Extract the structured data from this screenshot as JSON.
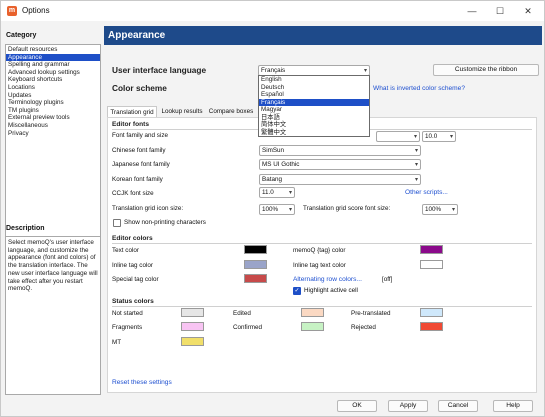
{
  "window": {
    "title": "Options",
    "icon_letter": "m"
  },
  "titlebar_buttons": {
    "minimize": "—",
    "maximize": "☐",
    "close": "✕"
  },
  "left": {
    "category_label": "Category",
    "categories": [
      "Default resources",
      "Appearance",
      "Spelling and grammar",
      "Advanced lookup settings",
      "Keyboard shortcuts",
      "Locations",
      "Updates",
      "Terminology plugins",
      "TM plugins",
      "External preview tools",
      "Miscellaneous",
      "Privacy"
    ],
    "selected_index": 1,
    "description_label": "Description",
    "description_text": "Select memoQ's user interface language, and customize the appearance (font and colors) of the translation interface. The new user interface language will take effect after you restart memoQ."
  },
  "main": {
    "header": "Appearance",
    "ui_language_label": "User interface language",
    "ui_language_value": "Français",
    "customize_ribbon_button": "Customize the ribbon",
    "color_scheme_label": "Color scheme",
    "inverted_link": "What is inverted color scheme?",
    "language_options": [
      "English",
      "Deutsch",
      "Español",
      "Français",
      "Magyar",
      "日本語",
      "简体中文",
      "繁體中文"
    ],
    "language_selected_index": 3,
    "tabs": [
      "Translation grid",
      "Lookup results",
      "Compare boxes"
    ],
    "editor_fonts": {
      "title": "Editor fonts",
      "font_family_label": "Font family and size",
      "font_size_value": "10.0",
      "chinese_label": "Chinese font family",
      "chinese_value": "SimSun",
      "japanese_label": "Japanese font family",
      "japanese_value": "MS UI Gothic",
      "korean_label": "Korean font family",
      "korean_value": "Batang",
      "ccjk_label": "CCJK font size",
      "ccjk_value": "11.0",
      "other_scripts_link": "Other scripts...",
      "grid_icon_label": "Translation grid icon size:",
      "grid_icon_value": "100%",
      "grid_score_label": "Translation grid score font size:",
      "grid_score_value": "100%",
      "show_nonprinting_label": "Show non-printing characters",
      "show_nonprinting_checked": false
    },
    "editor_colors": {
      "title": "Editor colors",
      "text_color_label": "Text color",
      "text_color": "#000000",
      "memoq_tag_label": "memoQ {tag} color",
      "memoq_tag_color": "#8b0a8b",
      "inline_tag_label": "Inline tag color",
      "inline_tag_color": "#9aa4c9",
      "inline_tag_text_label": "Inline tag text color",
      "inline_tag_text_color": "#ffffff",
      "special_tag_label": "Special tag color",
      "special_tag_color": "#c74a4a",
      "alternating_link": "Alternating row colors...",
      "alternating_value": "[off]",
      "highlight_label": "Highlight active cell",
      "highlight_checked": true
    },
    "status_colors": {
      "title": "Status colors",
      "not_started_label": "Not started",
      "not_started_color": "#e6e6e6",
      "edited_label": "Edited",
      "edited_color": "#fbd9c3",
      "pretranslated_label": "Pre-translated",
      "pretranslated_color": "#cfe8fb",
      "fragments_label": "Fragments",
      "fragments_color": "#f8c4f3",
      "confirmed_label": "Confirmed",
      "confirmed_color": "#c7f2c4",
      "rejected_label": "Rejected",
      "rejected_color": "#f04a34",
      "mt_label": "MT",
      "mt_color": "#f1df6a"
    },
    "reset_link": "Reset these settings"
  },
  "footer": {
    "ok": "OK",
    "apply": "Apply",
    "cancel": "Cancel",
    "help": "Help"
  }
}
